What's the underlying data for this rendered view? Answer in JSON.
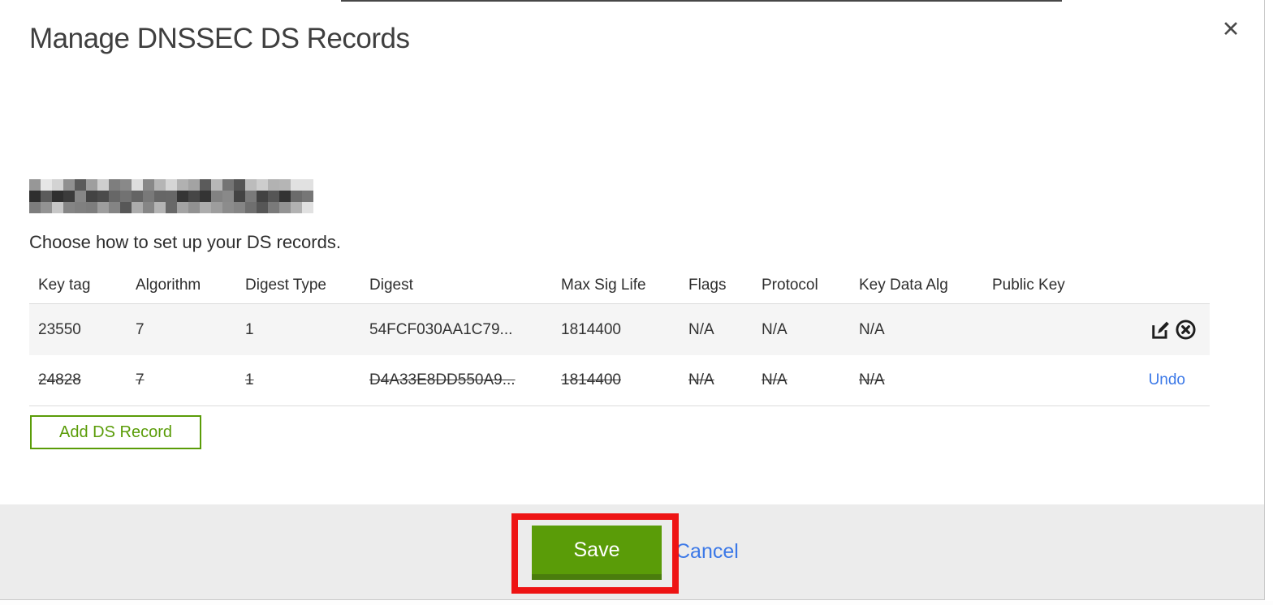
{
  "dialog": {
    "title": "Manage DNSSEC DS Records",
    "close_icon": "✕",
    "subtitle": "Choose how to set up your DS records."
  },
  "table": {
    "headers": [
      "Key tag",
      "Algorithm",
      "Digest Type",
      "Digest",
      "Max Sig Life",
      "Flags",
      "Protocol",
      "Key Data Alg",
      "Public Key"
    ],
    "rows": [
      {
        "state": "active",
        "cells": [
          "23550",
          "7",
          "1",
          "54FCF030AA1C79...",
          "1814400",
          "N/A",
          "N/A",
          "N/A",
          ""
        ]
      },
      {
        "state": "deleted",
        "cells": [
          "24828",
          "7",
          "1",
          "D4A33E8DD550A9...",
          "1814400",
          "N/A",
          "N/A",
          "N/A",
          ""
        ],
        "undo_label": "Undo"
      }
    ]
  },
  "buttons": {
    "add_ds_record": "Add DS Record",
    "save": "Save",
    "cancel": "Cancel"
  },
  "icons": {
    "edit": "edit-record-icon",
    "delete": "delete-record-icon"
  },
  "colors": {
    "action_green": "#5a9c08",
    "action_green_dark": "#4a7d0d",
    "link_blue": "#3b78e7",
    "annotation_red": "#ee1414",
    "footer_gray": "#ececec",
    "row_stripe_gray": "#f5f5f5"
  }
}
